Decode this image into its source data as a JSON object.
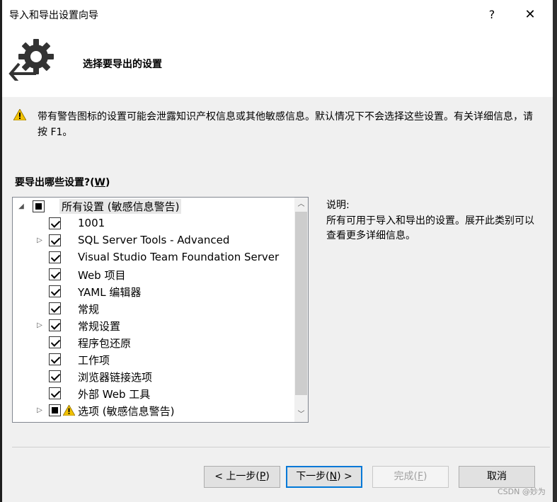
{
  "window": {
    "title": "导入和导出设置向导",
    "help_label": "?",
    "close_label": "✕"
  },
  "header": {
    "title": "选择要导出的设置"
  },
  "warning": {
    "text": "带有警告图标的设置可能会泄露知识产权信息或其他敏感信息。默认情况下不会选择这些设置。有关详细信息，请按 F1。"
  },
  "question": {
    "label": "要导出哪些设置?(",
    "accel": "W",
    "label_end": ")"
  },
  "tree": {
    "root": {
      "label": "所有设置 (敏感信息警告)",
      "state": "partial"
    },
    "items": [
      {
        "label": "1001",
        "state": "checked",
        "expandable": false,
        "warning": false
      },
      {
        "label": "SQL Server Tools - Advanced",
        "state": "checked",
        "expandable": true,
        "warning": false
      },
      {
        "label": "Visual Studio Team Foundation Server",
        "state": "checked",
        "expandable": false,
        "warning": false
      },
      {
        "label": "Web 项目",
        "state": "checked",
        "expandable": false,
        "warning": false
      },
      {
        "label": "YAML 编辑器",
        "state": "checked",
        "expandable": false,
        "warning": false
      },
      {
        "label": "常规",
        "state": "checked",
        "expandable": false,
        "warning": false
      },
      {
        "label": "常规设置",
        "state": "checked",
        "expandable": true,
        "warning": false
      },
      {
        "label": "程序包还原",
        "state": "checked",
        "expandable": false,
        "warning": false
      },
      {
        "label": "工作项",
        "state": "checked",
        "expandable": false,
        "warning": false
      },
      {
        "label": "浏览器链接选项",
        "state": "checked",
        "expandable": false,
        "warning": false
      },
      {
        "label": "外部 Web 工具",
        "state": "checked",
        "expandable": false,
        "warning": false
      },
      {
        "label": "选项 (敏感信息警告)",
        "state": "partial",
        "expandable": true,
        "warning": true
      }
    ]
  },
  "description": {
    "title": "说明:",
    "body": "所有可用于导入和导出的设置。展开此类别可以查看更多详细信息。"
  },
  "buttons": {
    "back": {
      "pre": "< 上一步(",
      "accel": "P",
      "post": ")"
    },
    "next": {
      "pre": "下一步(",
      "accel": "N",
      "post": ") >"
    },
    "finish": {
      "pre": "完成(",
      "accel": "F",
      "post": ")"
    },
    "cancel": {
      "label": "取消"
    }
  },
  "watermark": "CSDN @妙为",
  "colors": {
    "accent": "#0078d7",
    "warning": "#f2c200"
  }
}
